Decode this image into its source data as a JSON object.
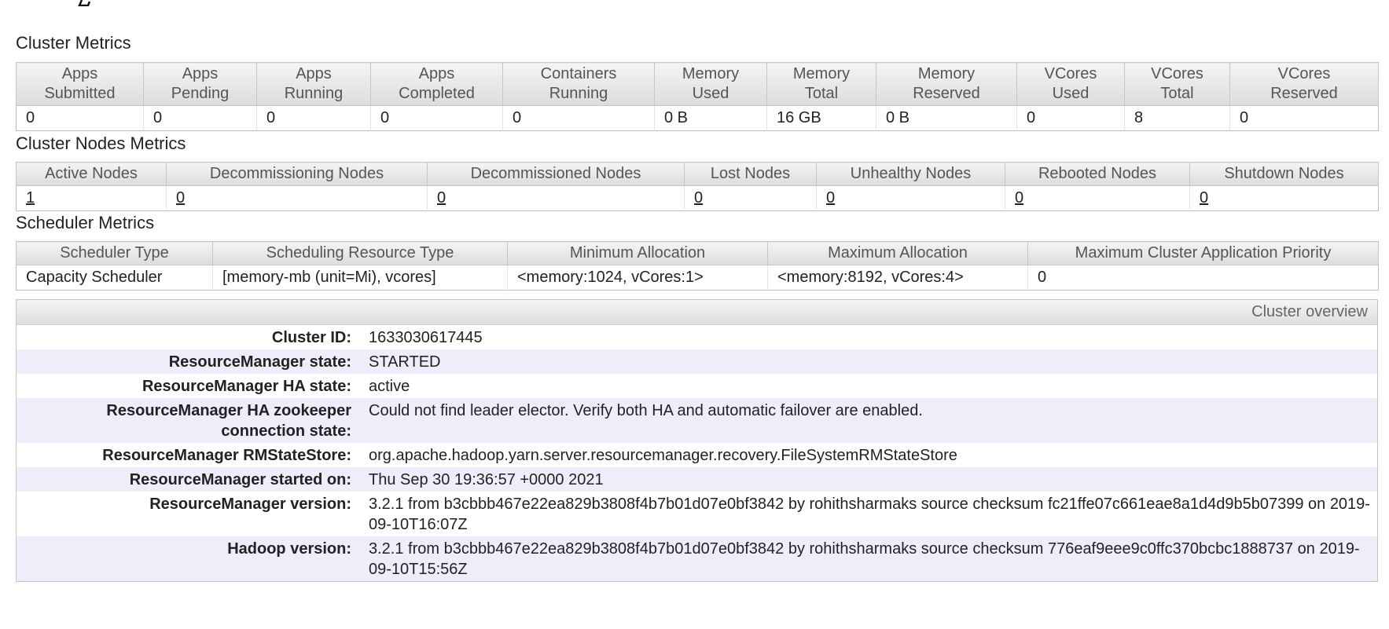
{
  "cluster_metrics": {
    "title": "Cluster Metrics",
    "headers": [
      [
        "Apps",
        "Submitted"
      ],
      [
        "Apps",
        "Pending"
      ],
      [
        "Apps",
        "Running"
      ],
      [
        "Apps",
        "Completed"
      ],
      [
        "Containers",
        "Running"
      ],
      [
        "Memory",
        "Used"
      ],
      [
        "Memory",
        "Total"
      ],
      [
        "Memory",
        "Reserved"
      ],
      [
        "VCores",
        "Used"
      ],
      [
        "VCores",
        "Total"
      ],
      [
        "VCores",
        "Reserved"
      ]
    ],
    "values": [
      "0",
      "0",
      "0",
      "0",
      "0",
      "0 B",
      "16 GB",
      "0 B",
      "0",
      "8",
      "0"
    ]
  },
  "cluster_nodes_metrics": {
    "title": "Cluster Nodes Metrics",
    "headers": [
      "Active Nodes",
      "Decommissioning Nodes",
      "Decommissioned Nodes",
      "Lost Nodes",
      "Unhealthy Nodes",
      "Rebooted Nodes",
      "Shutdown Nodes"
    ],
    "values": [
      "1",
      "0",
      "0",
      "0",
      "0",
      "0",
      "0"
    ]
  },
  "scheduler_metrics": {
    "title": "Scheduler Metrics",
    "headers": [
      "Scheduler Type",
      "Scheduling Resource Type",
      "Minimum Allocation",
      "Maximum Allocation",
      "Maximum Cluster Application Priority"
    ],
    "values": [
      "Capacity Scheduler",
      "[memory-mb (unit=Mi), vcores]",
      "<memory:1024, vCores:1>",
      "<memory:8192, vCores:4>",
      "0"
    ]
  },
  "cluster_overview": {
    "title": "Cluster overview",
    "rows": [
      {
        "label": "Cluster ID:",
        "value": "1633030617445"
      },
      {
        "label": "ResourceManager state:",
        "value": "STARTED"
      },
      {
        "label": "ResourceManager HA state:",
        "value": "active"
      },
      {
        "label": "ResourceManager HA zookeeper connection state:",
        "value": "Could not find leader elector. Verify both HA and automatic failover are enabled."
      },
      {
        "label": "ResourceManager RMStateStore:",
        "value": "org.apache.hadoop.yarn.server.resourcemanager.recovery.FileSystemRMStateStore"
      },
      {
        "label": "ResourceManager started on:",
        "value": "Thu Sep 30 19:36:57 +0000 2021"
      },
      {
        "label": "ResourceManager version:",
        "value": "3.2.1 from b3cbbb467e22ea829b3808f4b7b01d07e0bf3842 by rohithsharmaks source checksum fc21ffe07c661eae8a1d4d9b5b07399 on 2019-09-10T16:07Z"
      },
      {
        "label": "Hadoop version:",
        "value": "3.2.1 from b3cbbb467e22ea829b3808f4b7b01d07e0bf3842 by rohithsharmaks source checksum 776eaf9eee9c0ffc370bcbc1888737 on 2019-09-10T15:56Z"
      }
    ]
  }
}
